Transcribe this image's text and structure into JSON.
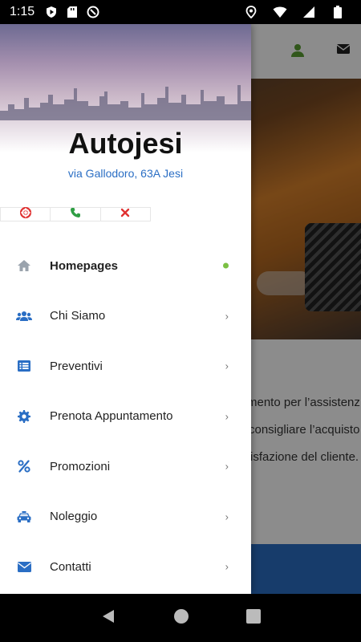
{
  "status_bar": {
    "time": "1:15"
  },
  "drawer": {
    "title": "Autojesi",
    "address": "via Gallodoro, 63A Jesi",
    "quick_actions": [
      {
        "icon": "lifebuoy-icon",
        "color": "#e03131"
      },
      {
        "icon": "phone-icon",
        "color": "#2f9e44"
      },
      {
        "icon": "close-icon",
        "color": "#e03131"
      }
    ],
    "menu": [
      {
        "label": "Homepages",
        "icon": "home-icon",
        "active": true
      },
      {
        "label": "Chi Siamo",
        "icon": "users-icon"
      },
      {
        "label": "Preventivi",
        "icon": "list-icon"
      },
      {
        "label": "Prenota Appuntamento",
        "icon": "gear-icon"
      },
      {
        "label": "Promozioni",
        "icon": "percent-icon"
      },
      {
        "label": "Noleggio",
        "icon": "taxi-icon"
      },
      {
        "label": "Contatti",
        "icon": "envelope-icon"
      }
    ],
    "chevron": "›"
  },
  "background_app": {
    "lines": [
      "mento per l’assistenz",
      "consigliare  l’acquisto",
      "isfazione del cliente."
    ]
  },
  "colors": {
    "accent_blue": "#2a6ec4",
    "active_dot": "#7bc043",
    "icon_blue": "#2a6ec4",
    "home_icon": "#9aa3ad"
  }
}
